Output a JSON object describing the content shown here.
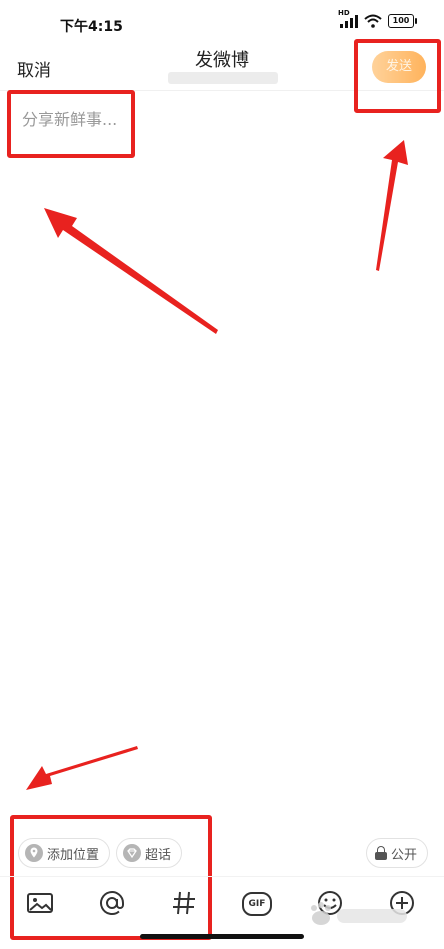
{
  "status_bar": {
    "time": "下午4:15",
    "signal_label": "HD",
    "battery": "100"
  },
  "header": {
    "cancel_label": "取消",
    "title": "发微博",
    "send_label": "发送"
  },
  "compose": {
    "placeholder": "分享新鲜事..."
  },
  "chips": {
    "location_label": "添加位置",
    "topic_label": "超话",
    "privacy_label": "公开"
  },
  "toolbar": {
    "items": [
      "image-icon",
      "mention-icon",
      "hashtag-icon",
      "gif-icon",
      "emoji-icon",
      "add-icon"
    ],
    "gif_label": "GIF"
  },
  "colors": {
    "send_button_start": "#ffd29a",
    "send_button_end": "#ffb35c",
    "annotation_red": "#e8221f"
  }
}
